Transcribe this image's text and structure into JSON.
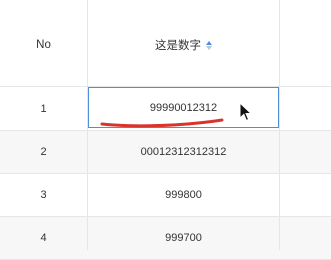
{
  "table": {
    "headers": {
      "no": "No",
      "number": "这是数字"
    },
    "sort_icon": "sort-ascending-icon",
    "rows": [
      {
        "no": "1",
        "number": "99990012312"
      },
      {
        "no": "2",
        "number": "00012312312312"
      },
      {
        "no": "3",
        "number": "999800"
      },
      {
        "no": "4",
        "number": "999700"
      }
    ]
  },
  "colors": {
    "selection_border": "#4e8fd4",
    "annotation": "#d9342b",
    "sort_active": "#4a8ee0"
  }
}
